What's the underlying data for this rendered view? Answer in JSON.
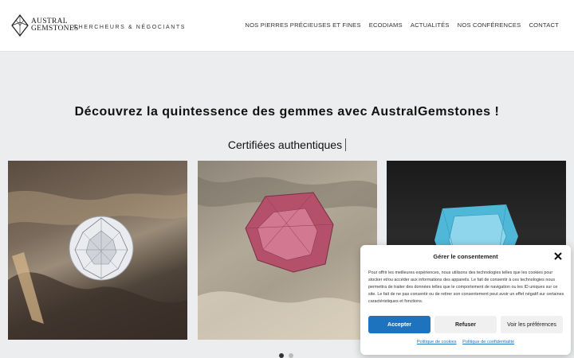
{
  "header": {
    "logo_line1": "AUSTRAL",
    "logo_line2": "GEMSTONES",
    "tagline": "CHERCHEURS & NÉGOCIANTS",
    "nav": [
      {
        "label": "NOS PIERRES PRÉCIEUSES ET FINES"
      },
      {
        "label": "ECODIAMS"
      },
      {
        "label": "ACTUALITÉS"
      },
      {
        "label": "NOS CONFÉRENCES"
      },
      {
        "label": "CONTACT"
      }
    ]
  },
  "hero": {
    "title": "Découvrez la quintessence des gemmes avec AustralGemstones !",
    "subtitle": "Certifiées authentiques"
  },
  "gallery": {
    "slides": [
      {
        "icon": "diamond-image"
      },
      {
        "icon": "pink-gem-image"
      },
      {
        "icon": "blue-gem-image"
      }
    ],
    "active_dot": 0
  },
  "consent": {
    "title": "Gérer le consentement",
    "text": "Pour offrir les meilleures expériences, nous utilisons des technologies telles que les cookies pour stocker et/ou accéder aux informations des appareils. Le fait de consentir à ces technologies nous permettra de traiter des données telles que le comportement de navigation ou les ID uniques sur ce site. Le fait de ne pas consentir ou de retirer son consentement peut avoir un effet négatif sur certaines caractéristiques et fonctions.",
    "accept_label": "Accepter",
    "refuse_label": "Refuser",
    "prefs_label": "Voir les préférences",
    "cookies_link": "Politique de cookies",
    "privacy_link": "Politique de confidentialité",
    "accent_color": "#1e73be"
  }
}
